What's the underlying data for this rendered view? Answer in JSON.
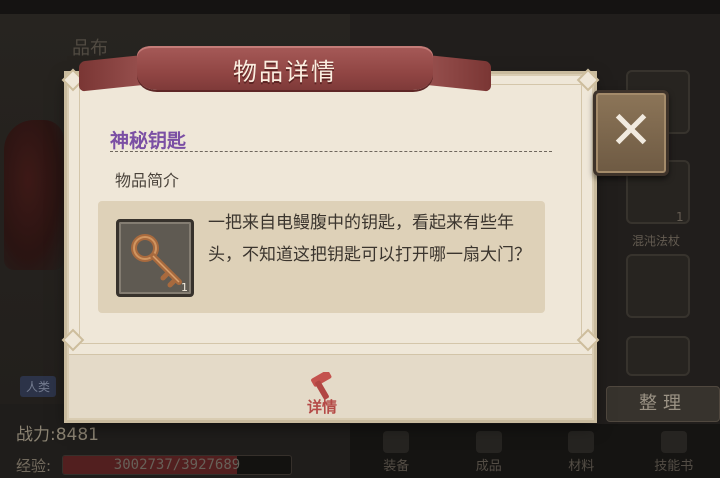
{
  "background": {
    "left_panel_title": "品布",
    "race_tag": "人类",
    "power_text": "战力:8481",
    "exp_label": "经验:",
    "exp_text": "3002737/3927689",
    "exp_progress": 0.764,
    "slot_label": "混沌法杖",
    "slot_count": "1",
    "sort_button": "整理",
    "tabs": [
      "装备",
      "成品",
      "材料",
      "技能书"
    ]
  },
  "modal": {
    "title": "物品详情",
    "item_name": "神秘钥匙",
    "section_title": "物品简介",
    "item_count": "1",
    "description": "一把来自电鳗腹中的钥匙，看起来有些年头，不知道这把钥匙可以打开哪一扇大门？",
    "detail_button": "详情",
    "close_glyph": "✕"
  },
  "colors": {
    "ribbon": "#914644",
    "item_name": "#7b4fa4",
    "detail_button": "#b44a47",
    "panel": "#efe7d8"
  },
  "icons": {
    "item": "bronze-key-icon",
    "detail": "hammer-icon",
    "close": "close-icon"
  }
}
